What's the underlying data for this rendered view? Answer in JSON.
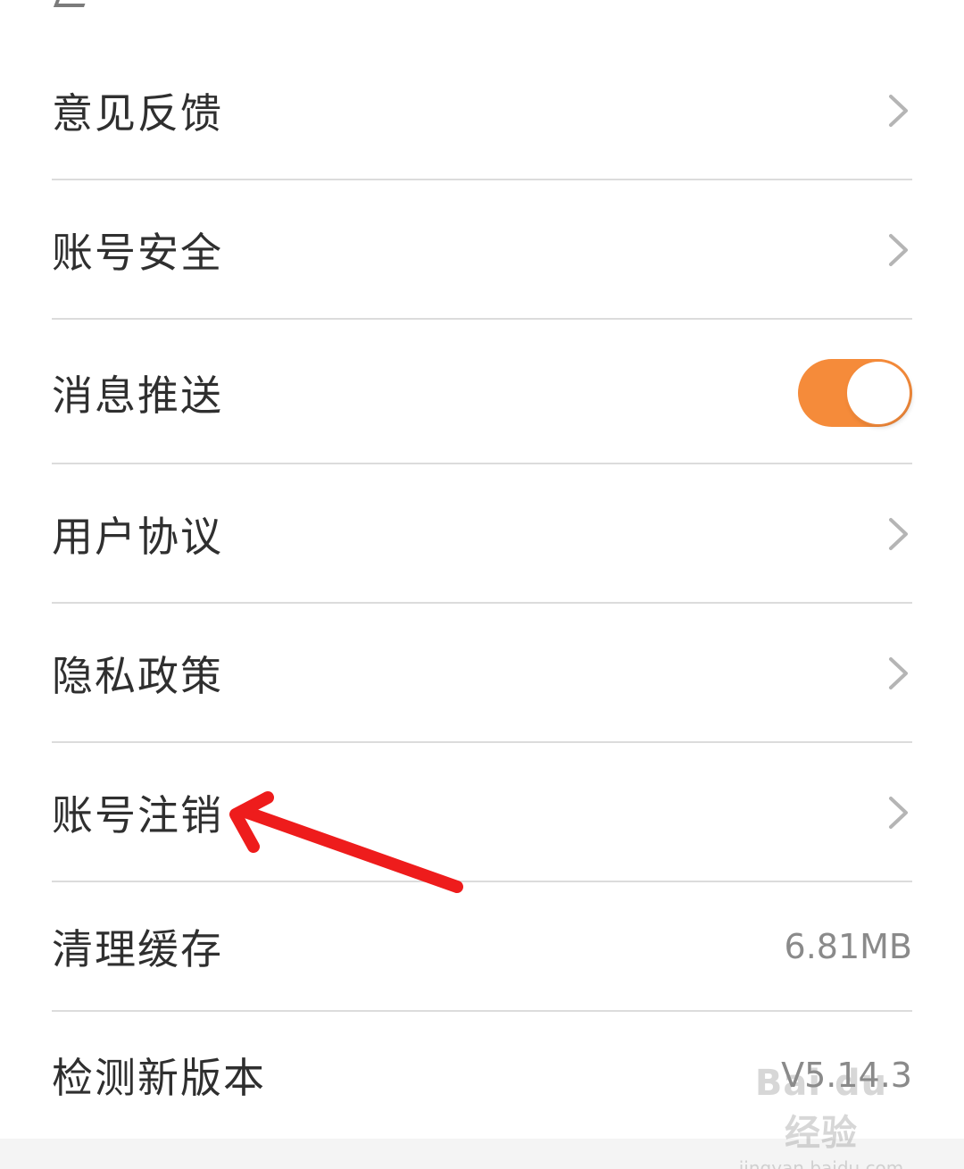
{
  "settings": {
    "items": [
      {
        "label": "意见反馈",
        "type": "link"
      },
      {
        "label": "账号安全",
        "type": "link"
      },
      {
        "label": "消息推送",
        "type": "toggle",
        "enabled": true
      },
      {
        "label": "用户协议",
        "type": "link"
      },
      {
        "label": "隐私政策",
        "type": "link"
      },
      {
        "label": "账号注销",
        "type": "link"
      },
      {
        "label": "清理缓存",
        "type": "value",
        "value": "6.81MB"
      },
      {
        "label": "检测新版本",
        "type": "value",
        "value": "V5.14.3"
      }
    ]
  },
  "colors": {
    "toggle_on": "#f58b3a",
    "annotation_arrow": "#ee1c1c",
    "divider": "#dcdcdc"
  },
  "icons": {
    "chevron": "chevron-right-icon",
    "annotation": "red-arrow-annotation"
  },
  "watermark": {
    "brand": "Bai du 经验",
    "url": "jingyan.baidu.com"
  }
}
